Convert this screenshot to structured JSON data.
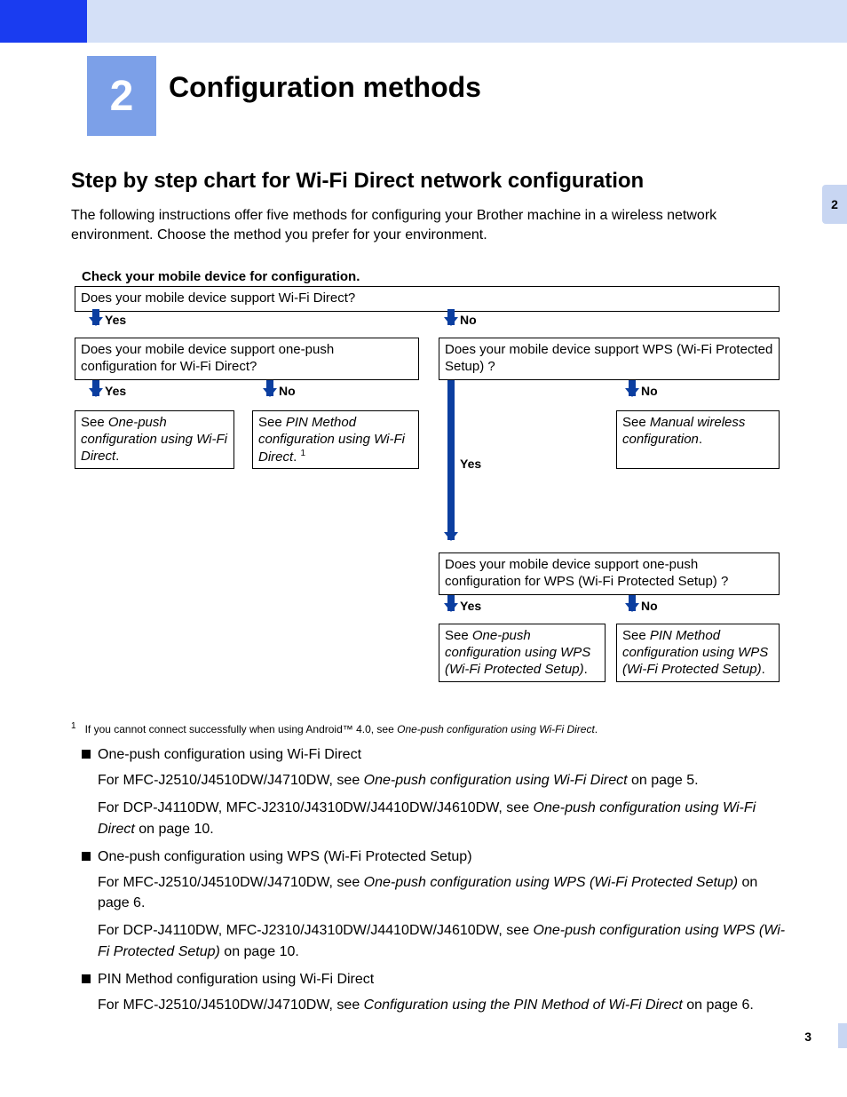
{
  "chapter": {
    "number": "2",
    "title": "Configuration methods"
  },
  "side_tab": "2",
  "section_title": "Step by step chart for Wi-Fi Direct network configuration",
  "intro": "The following instructions offer five methods for configuring your Brother machine in a wireless network environment. Choose the method you prefer for your environment.",
  "check_heading": "Check your mobile device for configuration.",
  "flow": {
    "q1": "Does your mobile device support Wi-Fi Direct?",
    "q2": "Does your mobile device support one-push configuration for Wi-Fi Direct?",
    "q3": "Does your mobile device support WPS (Wi-Fi Protected Setup) ?",
    "q4": "Does your mobile device support one-push configuration for WPS (Wi-Fi Protected Setup) ?",
    "a_yes": "Yes",
    "a_no": "No",
    "r1_pre": "See ",
    "r1_ital": "One-push configuration using Wi-Fi Direct",
    "r1_post": ".",
    "r2_pre": "See ",
    "r2_ital": "PIN Method configuration using Wi-Fi Direct",
    "r2_post": ". ",
    "r2_sup": "1",
    "r3_pre": "See ",
    "r3_ital": "Manual wireless configuration",
    "r3_post": ".",
    "r4_pre": "See ",
    "r4_ital": "One-push configuration using WPS (Wi-Fi Protected Setup)",
    "r4_post": ".",
    "r5_pre": "See ",
    "r5_ital": "PIN Method configuration using WPS (Wi-Fi Protected Setup)",
    "r5_post": "."
  },
  "footnote": {
    "marker": "1",
    "text_pre": "If you cannot connect successfully when using Android™ 4.0, see ",
    "text_ital": "One-push configuration using Wi-Fi Direct",
    "text_post": "."
  },
  "bullets": {
    "b1": "One-push configuration using Wi-Fi Direct",
    "b1s1_pre": "For MFC-J2510/J4510DW/J4710DW, see ",
    "b1s1_ital": "One-push configuration using Wi-Fi Direct",
    "b1s1_post": " on page 5.",
    "b1s2_pre": "For DCP-J4110DW, MFC-J2310/J4310DW/J4410DW/J4610DW, see ",
    "b1s2_ital": "One-push configuration using Wi-Fi Direct",
    "b1s2_post": " on page 10.",
    "b2": "One-push configuration using WPS (Wi-Fi Protected Setup)",
    "b2s1_pre": "For MFC-J2510/J4510DW/J4710DW, see ",
    "b2s1_ital": "One-push configuration using WPS (Wi-Fi Protected Setup)",
    "b2s1_post": " on page 6.",
    "b2s2_pre": "For DCP-J4110DW, MFC-J2310/J4310DW/J4410DW/J4610DW, see ",
    "b2s2_ital": "One-push configuration using WPS (Wi-Fi Protected Setup)",
    "b2s2_post": " on page 10.",
    "b3": "PIN Method configuration using Wi-Fi Direct",
    "b3s1_pre": "For MFC-J2510/J4510DW/J4710DW, see ",
    "b3s1_ital": "Configuration using the PIN Method of Wi-Fi Direct",
    "b3s1_post": " on page 6."
  },
  "page_number": "3"
}
